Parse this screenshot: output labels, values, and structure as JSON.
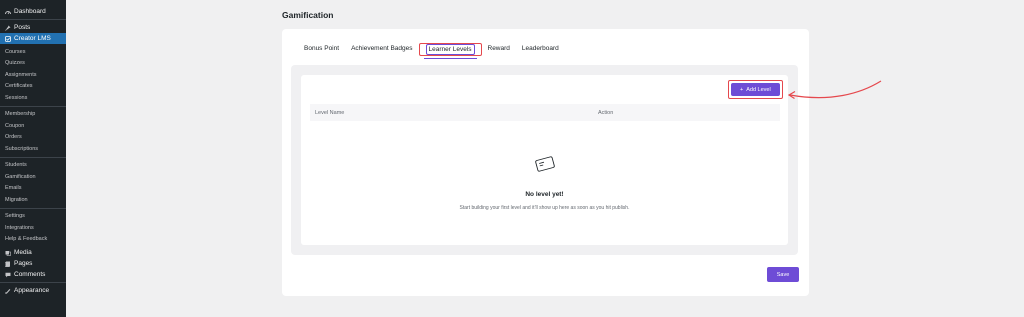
{
  "sidebar": {
    "top_items": [
      {
        "label": "Dashboard",
        "icon": "dashboard-icon"
      },
      {
        "label": "Posts",
        "icon": "pin-icon"
      },
      {
        "label": "Creator LMS",
        "icon": "lms-icon"
      }
    ],
    "lms_groups": [
      [
        "Courses",
        "Quizzes",
        "Assignments",
        "Certificates",
        "Sessions"
      ],
      [
        "Membership",
        "Coupon",
        "Orders",
        "Subscriptions"
      ],
      [
        "Students",
        "Gamification",
        "Emails",
        "Migration"
      ],
      [
        "Settings",
        "Integrations",
        "Help & Feedback"
      ]
    ],
    "bottom_items": [
      {
        "label": "Media",
        "icon": "media-icon"
      },
      {
        "label": "Pages",
        "icon": "pages-icon"
      },
      {
        "label": "Comments",
        "icon": "comments-icon"
      },
      {
        "label": "Appearance",
        "icon": "appearance-icon"
      }
    ]
  },
  "page": {
    "title": "Gamification"
  },
  "tabs": [
    "Bonus Point",
    "Achievement Badges",
    "Learner Levels",
    "Reward",
    "Leaderboard"
  ],
  "active_tab": "Learner Levels",
  "toolbar": {
    "add_level_label": "Add Level",
    "add_icon": "plus-icon"
  },
  "table": {
    "columns": [
      "Level Name",
      "Action"
    ]
  },
  "empty_state": {
    "icon": "card-icon",
    "title": "No level yet!",
    "description": "Start building your first level and it'll show up here as soon as you hit publish."
  },
  "footer": {
    "save_label": "Save"
  },
  "colors": {
    "accent": "#6e4cd6",
    "highlight": "#e5484d",
    "sidebar_bg": "#1d2327",
    "sidebar_active": "#2271b1"
  }
}
